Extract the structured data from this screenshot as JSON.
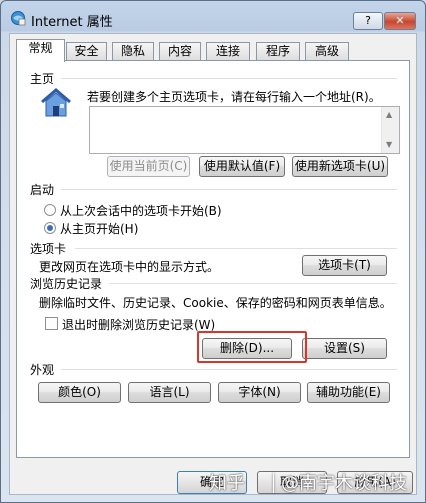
{
  "window": {
    "title": "Internet 属性",
    "help_label": "?",
    "close_label": "✕"
  },
  "tabs": [
    "常规",
    "安全",
    "隐私",
    "内容",
    "连接",
    "程序",
    "高级"
  ],
  "home": {
    "heading": "主页",
    "description": "若要创建多个主页选项卡，请在每行输入一个地址(R)。",
    "url_value": "",
    "buttons": {
      "use_current": "使用当前页(C)",
      "use_default": "使用默认值(F)",
      "use_new_tab": "使用新选项卡(U)"
    }
  },
  "startup": {
    "heading": "启动",
    "options": [
      "从上次会话中的选项卡开始(B)",
      "从主页开始(H)"
    ],
    "selected_index": 1
  },
  "tabs_section": {
    "heading": "选项卡",
    "description": "更改网页在选项卡中的显示方式。",
    "button": "选项卡(T)"
  },
  "history": {
    "heading": "浏览历史记录",
    "description": "删除临时文件、历史记录、Cookie、保存的密码和网页表单信息。",
    "checkbox_label": "退出时删除浏览历史记录(W)",
    "checkbox_checked": false,
    "delete_button": "删除(D)...",
    "settings_button": "设置(S)"
  },
  "appearance": {
    "heading": "外观",
    "buttons": [
      "颜色(O)",
      "语言(L)",
      "字体(N)",
      "辅助功能(E)"
    ]
  },
  "footer": {
    "ok": "确定",
    "cancel": "取消",
    "apply": "应用(A)"
  },
  "watermark": {
    "left": "知乎",
    "right": "@南宇木谈科技"
  },
  "colors": {
    "highlight": "#d9352a",
    "title_bar": "#c4d5ea",
    "close_button": "#c8462f"
  }
}
